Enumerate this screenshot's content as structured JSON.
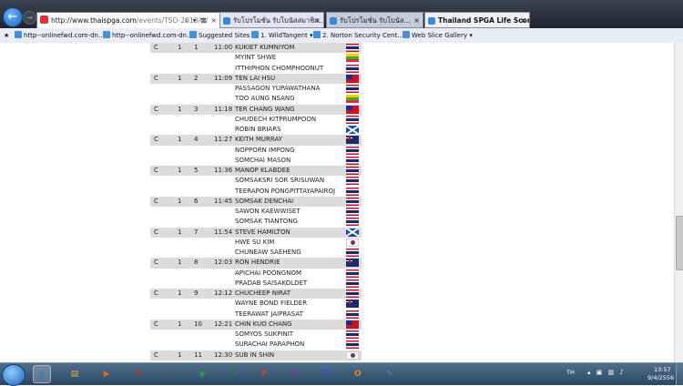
{
  "browser": {
    "address": {
      "domain": "thaispga.com",
      "prefix": "http://www.",
      "path": "/events/TSO-2013/tt/",
      "controls": "⌕ ▾ ⊠ ×"
    },
    "tabs": [
      {
        "label": "รับโปรโมชั่น รับโบนัสสมาชิก...",
        "close": "×"
      },
      {
        "label": "รับโปรโมชั่น รับโบนัส...",
        "close": "×"
      },
      {
        "label": "Thailand SPGA Life Scorebo...",
        "close": "×"
      }
    ],
    "favorites": [
      {
        "label": "http--onlinefwd.com-dn..."
      },
      {
        "label": "http--onlinefwd.com-dn..."
      },
      {
        "label": "Suggested Sites ▾"
      },
      {
        "label": "1. WildTangent ▾"
      },
      {
        "label": "2. Norton Security Cent... ▾"
      },
      {
        "label": "Web Slice Gallery ▾"
      }
    ]
  },
  "pairings": [
    {
      "course": "C",
      "round": "1",
      "group": "1",
      "time": "11:00",
      "players": [
        {
          "name": "KUKIET KUMNIYOM",
          "flag": "th"
        },
        {
          "name": "MYINT SHWE",
          "flag": "mm"
        },
        {
          "name": "ITTHIPHON CHOMPHOONUT",
          "flag": "th"
        }
      ]
    },
    {
      "course": "C",
      "round": "1",
      "group": "2",
      "time": "11:09",
      "players": [
        {
          "name": "TEN LAI HSU",
          "flag": "tw"
        },
        {
          "name": "PASSAGON YUPAWATHANA",
          "flag": "th"
        },
        {
          "name": "TOO AUNG NSANG",
          "flag": "mm"
        }
      ]
    },
    {
      "course": "C",
      "round": "1",
      "group": "3",
      "time": "11:18",
      "players": [
        {
          "name": "TER CHANG WANG",
          "flag": "tw"
        },
        {
          "name": "CHUDECH KITPRUMPOON",
          "flag": "th"
        },
        {
          "name": "ROBIN BRIARS",
          "flag": "sc"
        }
      ]
    },
    {
      "course": "C",
      "round": "1",
      "group": "4",
      "time": "11:27",
      "players": [
        {
          "name": "KEITH MURRAY",
          "flag": "au"
        },
        {
          "name": "NOPPORN IMPONG",
          "flag": "th"
        },
        {
          "name": "SOMCHAI MASON",
          "flag": "th"
        }
      ]
    },
    {
      "course": "C",
      "round": "1",
      "group": "5",
      "time": "11:36",
      "players": [
        {
          "name": "MANOP KLABDEE",
          "flag": "th"
        },
        {
          "name": "SOMSAKSRI SOR SRISUWAN",
          "flag": "th"
        },
        {
          "name": "TEERAPON PONGPITTAYAPAIROJ",
          "flag": "th"
        }
      ]
    },
    {
      "course": "C",
      "round": "1",
      "group": "6",
      "time": "11:45",
      "players": [
        {
          "name": "SOMSAK DENCHAI",
          "flag": "th"
        },
        {
          "name": "SAWON KAEWWISET",
          "flag": "th"
        },
        {
          "name": "SOMSAK TIANTONG",
          "flag": "th"
        }
      ]
    },
    {
      "course": "C",
      "round": "1",
      "group": "7",
      "time": "11:54",
      "players": [
        {
          "name": "STEVE HAMILTON",
          "flag": "sc"
        },
        {
          "name": "HWE SU KIM",
          "flag": "kr"
        },
        {
          "name": "CHUNEAW SAEHENG",
          "flag": "th"
        }
      ]
    },
    {
      "course": "C",
      "round": "1",
      "group": "8",
      "time": "12:03",
      "players": [
        {
          "name": "RON HENDRIE",
          "flag": "au"
        },
        {
          "name": "APICHAI POONGNOM",
          "flag": "th"
        },
        {
          "name": "PRADAB SAISAKOLDET",
          "flag": "th"
        }
      ]
    },
    {
      "course": "C",
      "round": "1",
      "group": "9",
      "time": "12:12",
      "players": [
        {
          "name": "CHUCHEEP NIRAT",
          "flag": "th"
        },
        {
          "name": "WAYNE BOND FIELDER",
          "flag": "au"
        },
        {
          "name": "TEERAWAT JAIPRASAT",
          "flag": "th"
        }
      ]
    },
    {
      "course": "C",
      "round": "1",
      "group": "10",
      "time": "12:21",
      "players": [
        {
          "name": "CHIN KUO CHANG",
          "flag": "tw"
        },
        {
          "name": "SOMYOS SUKPINIT",
          "flag": "th"
        },
        {
          "name": "SURACHAI PARAPHON",
          "flag": "th"
        }
      ]
    },
    {
      "course": "C",
      "round": "1",
      "group": "11",
      "time": "12:30",
      "players": [
        {
          "name": "SUB IN SHIN",
          "flag": "kr"
        }
      ]
    }
  ],
  "taskbar": {
    "apps": [
      {
        "name": "internet-explorer",
        "glyph": "e",
        "color": "#2a7fd8"
      },
      {
        "name": "file-explorer",
        "glyph": "▤",
        "color": "#e0b040"
      },
      {
        "name": "media-player",
        "glyph": "▶",
        "color": "#e06a20"
      },
      {
        "name": "pin-app",
        "glyph": "⚑",
        "color": "#c0302a"
      },
      {
        "name": "steering-app",
        "glyph": "⊙",
        "color": "#555555"
      },
      {
        "name": "chrome",
        "glyph": "◉",
        "color": "#2e9d4a"
      },
      {
        "name": "excel",
        "glyph": "X",
        "color": "#1f7a3a"
      },
      {
        "name": "powerpoint",
        "glyph": "P",
        "color": "#c8452a"
      },
      {
        "name": "onenote",
        "glyph": "N",
        "color": "#7a3a9a"
      },
      {
        "name": "word",
        "glyph": "W",
        "color": "#2a5ab0"
      },
      {
        "name": "outlook",
        "glyph": "O",
        "color": "#e0892a"
      },
      {
        "name": "paint",
        "glyph": "✎",
        "color": "#4a8ad0"
      }
    ],
    "lang": "TH",
    "tray": "▴ ▣ ▥ ♪",
    "time": "13:57",
    "date": "9/4/2556"
  }
}
